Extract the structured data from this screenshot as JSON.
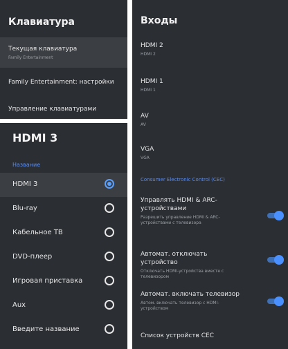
{
  "keyboard": {
    "title": "Клавиатура",
    "items": [
      {
        "label": "Текущая клавиатура",
        "sub": "Family Entertainment"
      },
      {
        "label": "Family Entertainment: настройки",
        "sub": ""
      },
      {
        "label": "Управление клавиатурами",
        "sub": ""
      }
    ]
  },
  "hdmi3": {
    "title": "HDMI 3",
    "category": "Название",
    "options": [
      {
        "label": "HDMI 3",
        "selected": true
      },
      {
        "label": "Blu-ray",
        "selected": false
      },
      {
        "label": "Кабельное ТВ",
        "selected": false
      },
      {
        "label": "DVD-плеер",
        "selected": false
      },
      {
        "label": "Игровая приставка",
        "selected": false
      },
      {
        "label": "Aux",
        "selected": false
      },
      {
        "label": "Введите название",
        "selected": false
      }
    ]
  },
  "inputs": {
    "title": "Входы",
    "sources": [
      {
        "label": "HDMI 2",
        "sub": "HDMI 2"
      },
      {
        "label": "HDMI 1",
        "sub": "HDMI 1"
      },
      {
        "label": "AV",
        "sub": "AV"
      },
      {
        "label": "VGA",
        "sub": "VGA"
      }
    ],
    "cec_header": "Consumer Electronic Control (CEC)",
    "toggles": [
      {
        "label": "Управлять HDMI & ARC-устройствами",
        "sub": "Разрешить управление HDMI & ARC-устройствами с телевизора",
        "on": true
      },
      {
        "label": "Автомат. отключать устройство",
        "sub": "Отключать HDMI-устройства вместе с телевизором",
        "on": true
      },
      {
        "label": "Автомат. включать телевизор",
        "sub": "Автом. включать телевизор с HDMI-устройством",
        "on": true
      }
    ],
    "device_list": "Список устройств CEC"
  },
  "colors": {
    "panel": "#2b2e33",
    "accent": "#4a90ff",
    "category": "#5b8def"
  }
}
